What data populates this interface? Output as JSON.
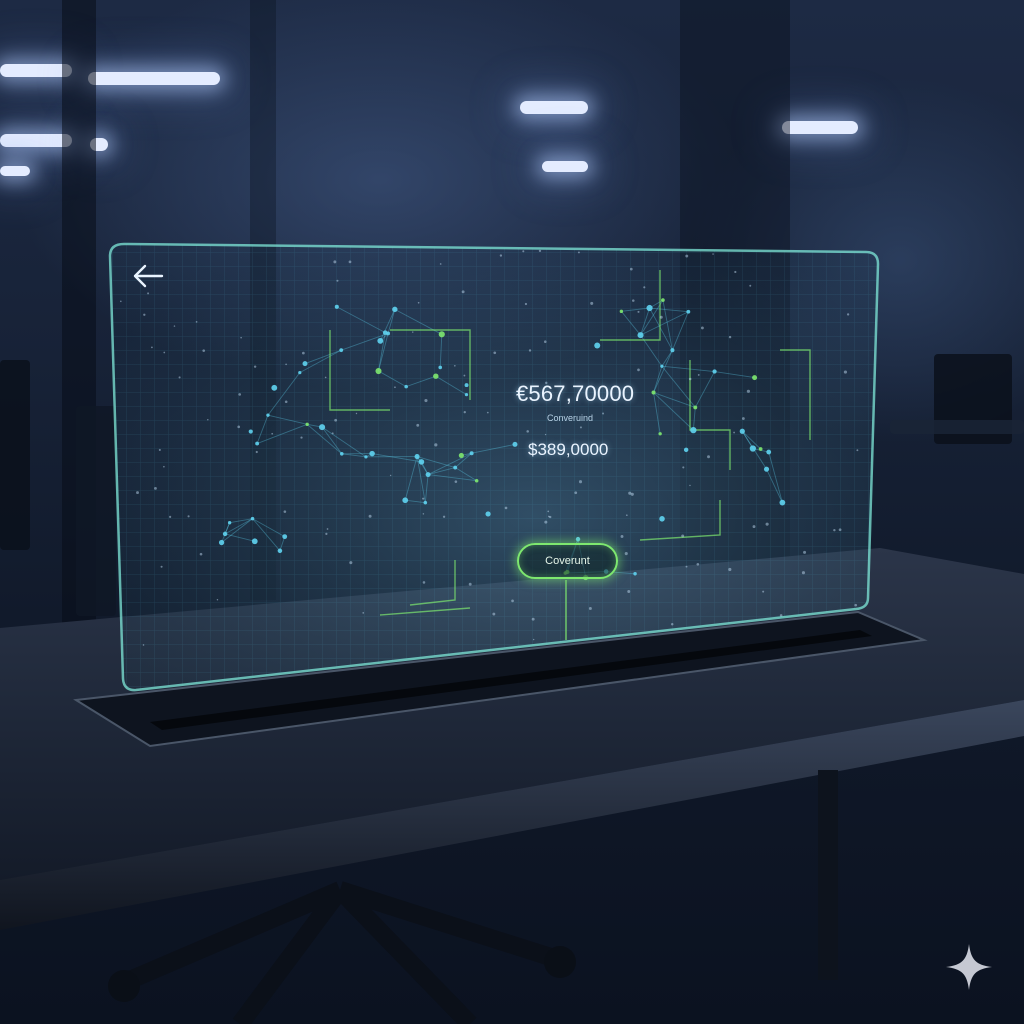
{
  "converter": {
    "amount_primary": "€567,70000",
    "amount_sub_label": "Converuind",
    "amount_secondary": "$389,0000",
    "convert_button_label": "Coverunt"
  },
  "icons": {
    "back": "arrow-left-icon",
    "watermark": "sparkle-icon"
  },
  "colors": {
    "accent_green": "#7ee86f",
    "accent_cyan": "#5fd3f0",
    "panel_edge": "#7fe8d8",
    "background": "#0c1322"
  }
}
